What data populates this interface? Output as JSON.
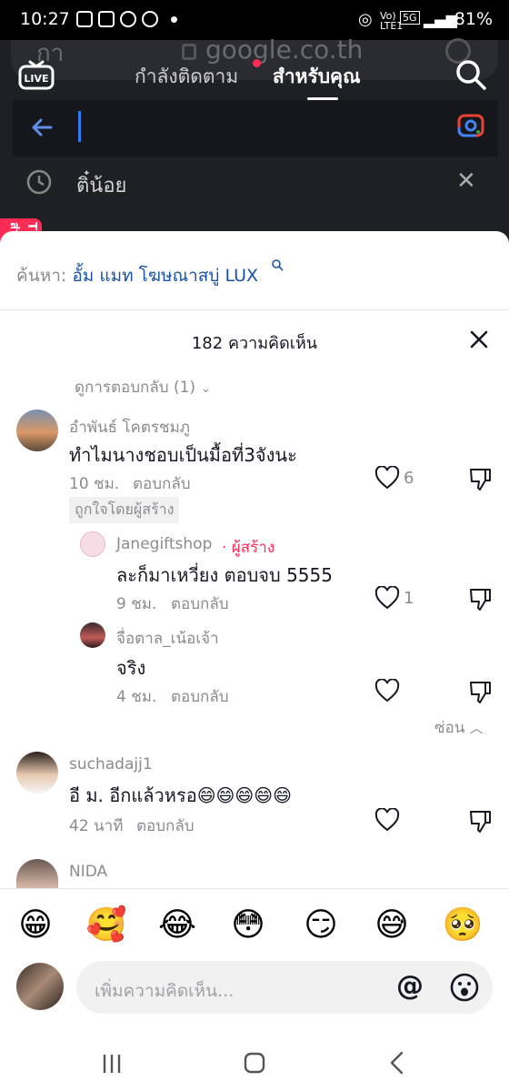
{
  "status_bar": {
    "time": "10:27",
    "network_labels": "Vo) LTE1",
    "network_type": "5G",
    "battery": "81%"
  },
  "background_app": {
    "url": "google.co.th",
    "url_left_text": "กา",
    "tab_following": "กำลังติดตาม",
    "tab_foryou": "สำหรับคุณ",
    "history_item": "ติ๋น้อย",
    "tiktok_badge": "TikTok ส่วนลด"
  },
  "comments_sheet": {
    "search_label": "ค้นหา: ",
    "search_query": "อั้ม แมท โฆษณาสบู่ LUX",
    "title": "182 ความคิดเห็น",
    "view_replies": "ดูการตอบกลับ (1)",
    "hide_label": "ซ่อน",
    "comments": [
      {
        "author": "อำพันธ์ โคตรชมภู",
        "text": "ทำไมนางชอบเป็นมื้อที่3จังนะ",
        "time": "10 ชม.",
        "reply_label": "ตอบกลับ",
        "likes": "6",
        "liked_by_creator": "ถูกใจโดยผู้สร้าง"
      },
      {
        "author": "Janegiftshop",
        "author_tag": "· ผู้สร้าง",
        "text": "ละก็มาเหวี่ยง ตอบจบ 5555",
        "time": "9 ชม.",
        "reply_label": "ตอบกลับ",
        "likes": "1"
      },
      {
        "author": "จื่อตาล_เน้อเจ้า",
        "text": "จริง",
        "time": "4 ชม.",
        "reply_label": "ตอบกลับ",
        "likes": ""
      },
      {
        "author": "suchadajj1",
        "text": "อี ม. อีกแล้วหรอ😄😄😄😄😄",
        "time": "42 นาที",
        "reply_label": "ตอบกลับ",
        "likes": ""
      },
      {
        "author": "NIDA"
      }
    ],
    "emoji_row": [
      "😁",
      "🥰",
      "😂",
      "😳",
      "😏",
      "😅",
      "🥺"
    ],
    "input_placeholder": "เพิ่มความคิดเห็น...",
    "at_symbol": "@"
  }
}
